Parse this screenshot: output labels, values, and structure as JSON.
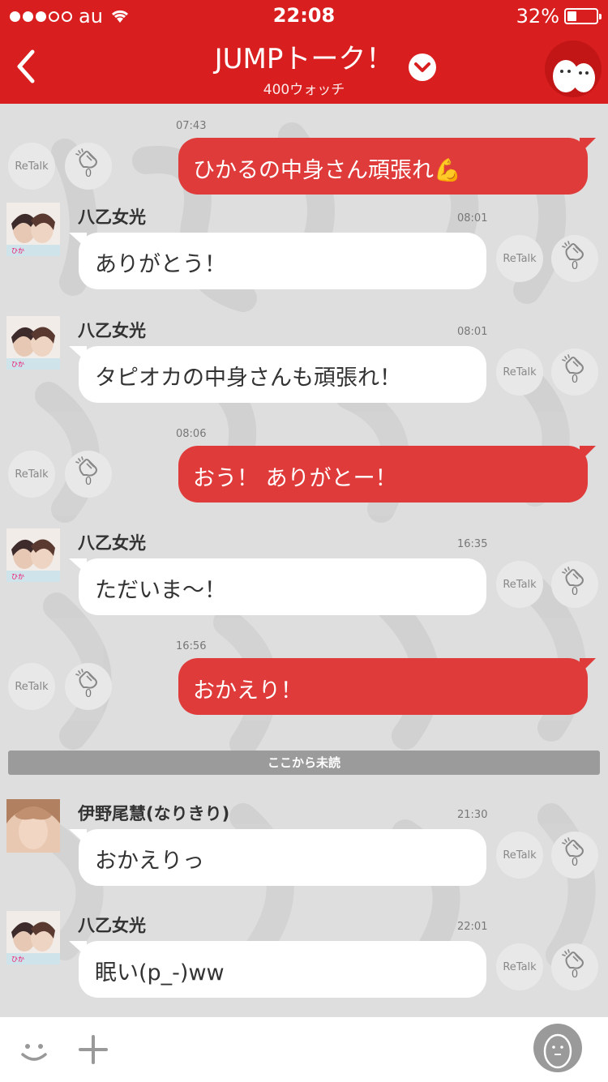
{
  "status_bar": {
    "carrier": "au",
    "time": "22:08",
    "battery_percent": "32%",
    "battery_level": 0.32,
    "signal_dots_filled": 3,
    "signal_dots_total": 5
  },
  "header": {
    "title": "JUMPトーク！",
    "subtitle": "400ウォッチ"
  },
  "colors": {
    "brand_red": "#d81e1e",
    "outgoing_bubble": "#e03b3b",
    "incoming_bubble": "#ffffff",
    "unread_divider": "#9b9b9b"
  },
  "retalk_label": "ReTalk",
  "unread_label": "ここから未読",
  "messages": [
    {
      "dir": "out",
      "time": "07:43",
      "text": "ひかるの中身さん頑張れ💪",
      "claps": "0"
    },
    {
      "dir": "in",
      "name": "八乙女光",
      "time": "08:01",
      "text": "ありがとう！",
      "claps": "0"
    },
    {
      "dir": "in",
      "name": "八乙女光",
      "time": "08:01",
      "text": "タピオカの中身さんも頑張れ！",
      "claps": "0"
    },
    {
      "dir": "out",
      "time": "08:06",
      "text": "おう！ ありがとー！",
      "claps": "0"
    },
    {
      "dir": "in",
      "name": "八乙女光",
      "time": "16:35",
      "text": "ただいま〜！",
      "claps": "0"
    },
    {
      "dir": "out",
      "time": "16:56",
      "text": "おかえり！",
      "claps": "0"
    },
    {
      "dir": "in",
      "name": "伊野尾慧(なりきり)",
      "time": "21:30",
      "text": "おかえりっ",
      "claps": "0"
    },
    {
      "dir": "in",
      "name": "八乙女光",
      "time": "22:01",
      "text": "眠い(p_-)ww",
      "claps": "0"
    }
  ],
  "icons": {
    "back": "chevron-left-icon",
    "dropdown": "chevron-down-icon",
    "ghost": "ghost-avatar-icon",
    "clap": "clap-icon",
    "smile": "smile-icon",
    "plus": "plus-icon",
    "user": "user-icon"
  }
}
